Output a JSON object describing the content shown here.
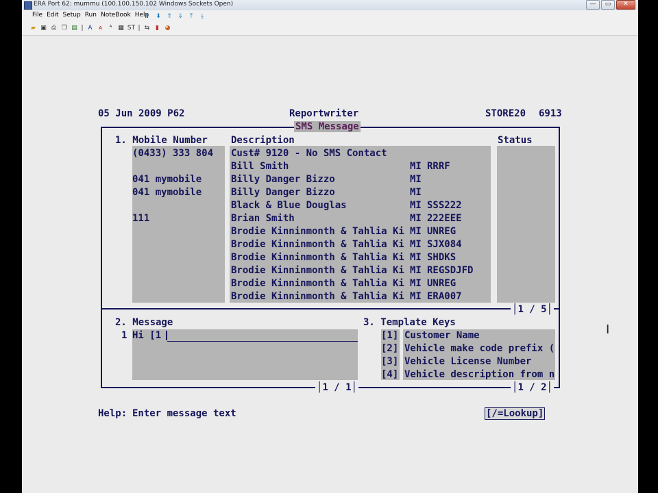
{
  "window": {
    "title": "ERA Port 62: mummu (100.100.150.102 Windows Sockets Open)",
    "min_label": "—",
    "max_label": "▭",
    "close_label": "✕"
  },
  "menubar": {
    "items": [
      "File",
      "Edit",
      "Setup",
      "Run",
      "NoteBook",
      "Help"
    ]
  },
  "header": {
    "date": "05 Jun 2009 P62",
    "app": "Reportwriter",
    "store": "STORE20",
    "number": "6913"
  },
  "sms": {
    "title": "SMS Message",
    "col_mobile": "1. Mobile Number",
    "col_description": "Description",
    "col_status": "Status",
    "rows": [
      {
        "mobile": "(0433) 333 804",
        "description": "Cust# 9120 - No SMS Contact",
        "code": "",
        "rego": ""
      },
      {
        "mobile": "",
        "description": "Bill Smith",
        "code": "MI",
        "rego": "RRRF"
      },
      {
        "mobile": "041 mymobile",
        "description": "Billy Danger Bizzo",
        "code": "MI",
        "rego": ""
      },
      {
        "mobile": "041 mymobile",
        "description": "Billy Danger Bizzo",
        "code": "MI",
        "rego": ""
      },
      {
        "mobile": "",
        "description": "Black & Blue Douglas",
        "code": "MI",
        "rego": "SSS222"
      },
      {
        "mobile": "111",
        "description": "Brian Smith",
        "code": "MI",
        "rego": "222EEE"
      },
      {
        "mobile": "",
        "description": "Brodie Kinninmonth & Tahlia Ki",
        "code": "MI",
        "rego": "UNREG"
      },
      {
        "mobile": "",
        "description": "Brodie Kinninmonth & Tahlia Ki",
        "code": "MI",
        "rego": "SJX084"
      },
      {
        "mobile": "",
        "description": "Brodie Kinninmonth & Tahlia Ki",
        "code": "MI",
        "rego": "SHDKS"
      },
      {
        "mobile": "",
        "description": "Brodie Kinninmonth & Tahlia Ki",
        "code": "MI",
        "rego": "REGSDJFD"
      },
      {
        "mobile": "",
        "description": "Brodie Kinninmonth & Tahlia Ki",
        "code": "MI",
        "rego": "UNREG"
      },
      {
        "mobile": "",
        "description": "Brodie Kinninmonth & Tahlia Ki",
        "code": "MI",
        "rego": "ERA007"
      }
    ],
    "page": "1 / 5"
  },
  "message": {
    "label": "2. Message",
    "line_no": "1",
    "text": "Hi [1",
    "page": "1 / 1"
  },
  "template_keys": {
    "label": "3. Template Keys",
    "items": [
      {
        "key": "[1]",
        "text": "Customer Name"
      },
      {
        "key": "[2]",
        "text": "Vehicle make code prefix ("
      },
      {
        "key": "[3]",
        "text": "Vehicle License Number"
      },
      {
        "key": "[4]",
        "text": "Vehicle description from n"
      }
    ],
    "page": "1 / 2"
  },
  "help": {
    "label": "Help:",
    "text": "Enter message text",
    "lookup": "[/=Lookup]"
  }
}
